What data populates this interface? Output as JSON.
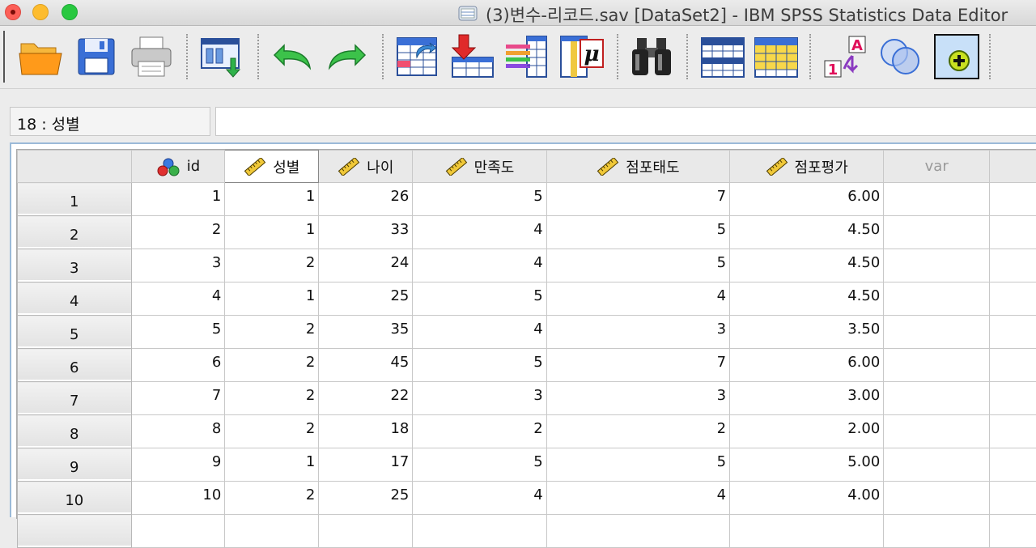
{
  "window": {
    "title": "(3)변수-리코드.sav [DataSet2] - IBM SPSS Statistics Data Editor"
  },
  "toolbar": {
    "buttons": [
      {
        "name": "open-data-document-button",
        "icon": "folder-open-icon"
      },
      {
        "name": "save-document-button",
        "icon": "floppy-disk-icon"
      },
      {
        "name": "print-button",
        "icon": "printer-icon"
      },
      {
        "name": "recall-dialog-button",
        "icon": "dialog-recall-icon"
      },
      {
        "name": "undo-button",
        "icon": "undo-arrow-icon"
      },
      {
        "name": "redo-button",
        "icon": "redo-arrow-icon"
      },
      {
        "name": "go-to-case-button",
        "icon": "goto-case-icon"
      },
      {
        "name": "go-to-variable-button",
        "icon": "goto-variable-icon"
      },
      {
        "name": "variables-button",
        "icon": "variables-list-icon"
      },
      {
        "name": "run-descriptives-button",
        "icon": "mu-statistics-icon"
      },
      {
        "name": "find-button",
        "icon": "binoculars-icon"
      },
      {
        "name": "insert-cases-button",
        "icon": "insert-cases-icon"
      },
      {
        "name": "insert-variable-button",
        "icon": "insert-variable-icon"
      },
      {
        "name": "value-labels-button",
        "icon": "value-labels-icon"
      },
      {
        "name": "use-variable-sets-button",
        "icon": "variable-sets-icon"
      },
      {
        "name": "spelling-button",
        "icon": "spelling-plus-icon"
      }
    ]
  },
  "cell_editor": {
    "reference": "18 : 성별",
    "value": ""
  },
  "grid": {
    "columns": [
      {
        "label": "id",
        "icon": "nominal-icon"
      },
      {
        "label": "성별",
        "icon": "scale-ruler-icon",
        "active": true
      },
      {
        "label": "나이",
        "icon": "scale-ruler-icon"
      },
      {
        "label": "만족도",
        "icon": "scale-ruler-icon"
      },
      {
        "label": "점포태도",
        "icon": "scale-ruler-icon"
      },
      {
        "label": "점포평가",
        "icon": "scale-ruler-icon"
      },
      {
        "label": "var",
        "icon": ""
      }
    ],
    "rows": [
      {
        "num": "1",
        "cells": [
          "1",
          "1",
          "26",
          "5",
          "7",
          "6.00"
        ]
      },
      {
        "num": "2",
        "cells": [
          "2",
          "1",
          "33",
          "4",
          "5",
          "4.50"
        ]
      },
      {
        "num": "3",
        "cells": [
          "3",
          "2",
          "24",
          "4",
          "5",
          "4.50"
        ]
      },
      {
        "num": "4",
        "cells": [
          "4",
          "1",
          "25",
          "5",
          "4",
          "4.50"
        ]
      },
      {
        "num": "5",
        "cells": [
          "5",
          "2",
          "35",
          "4",
          "3",
          "3.50"
        ]
      },
      {
        "num": "6",
        "cells": [
          "6",
          "2",
          "45",
          "5",
          "7",
          "6.00"
        ]
      },
      {
        "num": "7",
        "cells": [
          "7",
          "2",
          "22",
          "3",
          "3",
          "3.00"
        ]
      },
      {
        "num": "8",
        "cells": [
          "8",
          "2",
          "18",
          "2",
          "2",
          "2.00"
        ]
      },
      {
        "num": "9",
        "cells": [
          "9",
          "1",
          "17",
          "5",
          "5",
          "5.00"
        ]
      },
      {
        "num": "10",
        "cells": [
          "10",
          "2",
          "25",
          "4",
          "4",
          "4.00"
        ]
      }
    ]
  }
}
